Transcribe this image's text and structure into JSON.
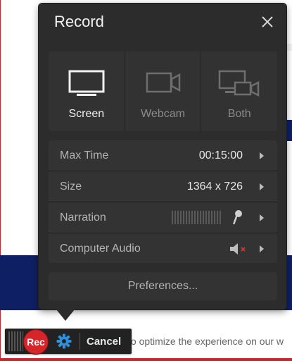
{
  "background_page": {
    "snippet": "to optimize the experience on our w"
  },
  "panel": {
    "title": "Record"
  },
  "sources": [
    {
      "label": "Screen",
      "active": true
    },
    {
      "label": "Webcam",
      "active": false
    },
    {
      "label": "Both",
      "active": false
    }
  ],
  "settings": {
    "max_time": {
      "label": "Max Time",
      "value": "00:15:00"
    },
    "size": {
      "label": "Size",
      "value": "1364 x 726"
    },
    "narration": {
      "label": "Narration"
    },
    "computer_audio": {
      "label": "Computer Audio"
    }
  },
  "preferences_label": "Preferences...",
  "toolbar": {
    "rec_label": "Rec",
    "cancel_label": "Cancel"
  },
  "colors": {
    "panel_bg": "#2c2c2c",
    "accent_red": "#d5242a",
    "gear_blue": "#2f8fdc",
    "page_band": "#0f1f63"
  }
}
